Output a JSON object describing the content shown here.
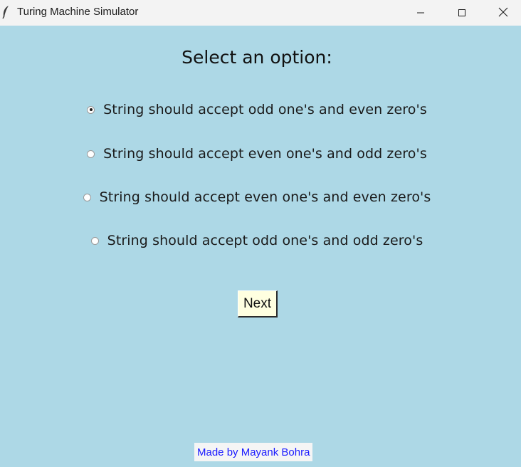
{
  "window": {
    "title": "Turing Machine Simulator",
    "icon": "feather-icon",
    "controls": [
      "minimize-icon",
      "maximize-icon",
      "close-icon"
    ]
  },
  "main": {
    "heading": "Select an option:",
    "selected_index": 0,
    "options": [
      {
        "label": "String should accept odd one's and even zero's",
        "checked": true
      },
      {
        "label": "String should accept even one's and odd zero's",
        "checked": false
      },
      {
        "label": "String should accept even one's and even zero's",
        "checked": false
      },
      {
        "label": "String should accept odd one's and odd zero's",
        "checked": false
      }
    ],
    "next_label": "Next"
  },
  "footer": {
    "credit": "Made by Mayank Bohra"
  },
  "colors": {
    "background": "#add8e6",
    "button_bg": "#ffffe0",
    "credit_text": "#1a1aff"
  }
}
